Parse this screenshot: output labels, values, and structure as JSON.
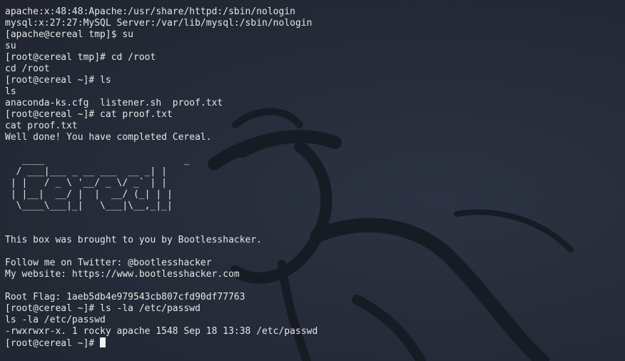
{
  "terminal": {
    "lines": [
      "",
      "apache:x:48:48:Apache:/usr/share/httpd:/sbin/nologin",
      "mysql:x:27:27:MySQL Server:/var/lib/mysql:/sbin/nologin",
      "[apache@cereal tmp]$ su",
      "su",
      "[root@cereal tmp]# cd /root",
      "cd /root",
      "[root@cereal ~]# ls",
      "ls",
      "anaconda-ks.cfg  listener.sh  proof.txt",
      "[root@cereal ~]# cat proof.txt",
      "cat proof.txt",
      "Well done! You have completed Cereal.",
      "",
      "   ____                         _ ",
      "  / ___|___ _ __ ___  __ _| |",
      " | |   / _ \\ '__/ _ \\/ _` | |",
      " | |__|  __/ |  |  __/ (_| | |",
      "  \\____\\___|_|   \\___|\\__,_|_|",
      "",
      "",
      "This box was brought to you by Bootlesshacker.",
      "",
      "Follow me on Twitter: @bootlesshacker",
      "My website: https://www.bootlesshacker.com",
      "",
      "Root Flag: 1aeb5db4e979543cb807cfd90df77763",
      "[root@cereal ~]# ls -la /etc/passwd",
      "ls -la /etc/passwd",
      "-rwxrwxr-x. 1 rocky apache 1548 Sep 18 13:38 /etc/passwd"
    ],
    "prompt": "[root@cereal ~]# "
  }
}
